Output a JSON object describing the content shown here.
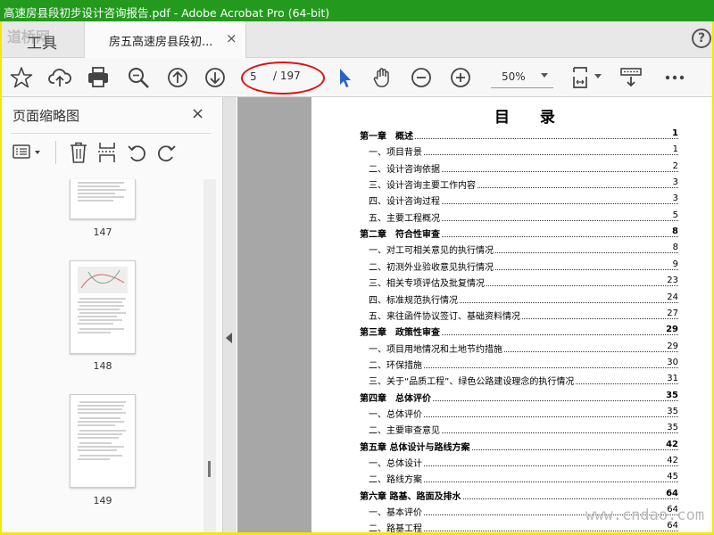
{
  "window": {
    "title": "高速房县段初步设计咨询报告.pdf - Adobe Acrobat Pro (64-bit)"
  },
  "tabs": {
    "tools_label": "工具",
    "doc_label": "房五高速房县段初...",
    "close_glyph": "×",
    "help_glyph": "?"
  },
  "toolbar": {
    "icons": [
      "bookmark-star-icon",
      "upload-cloud-icon",
      "print-icon",
      "search-icon",
      "prev-page-icon",
      "next-page-icon",
      "select-cursor-icon",
      "hand-tool-icon",
      "zoom-out-icon",
      "zoom-in-icon",
      "fit-page-icon",
      "read-mode-icon",
      "more-icon"
    ],
    "page_current": "5",
    "page_total": "/ 197",
    "zoom": "50%"
  },
  "sidebar": {
    "title": "页面缩略图",
    "close_glyph": "×",
    "thumbnails": [
      {
        "label": "147"
      },
      {
        "label": "148"
      },
      {
        "label": "149"
      }
    ]
  },
  "toc": {
    "title": "目 录",
    "entries": [
      {
        "text": "第一章　概述",
        "page": "1",
        "level": "chapter"
      },
      {
        "text": "一、项目背景",
        "page": "1",
        "level": "section"
      },
      {
        "text": "二、设计咨询依据",
        "page": "2",
        "level": "section"
      },
      {
        "text": "三、设计咨询主要工作内容",
        "page": "3",
        "level": "section"
      },
      {
        "text": "四、设计咨询过程",
        "page": "3",
        "level": "section"
      },
      {
        "text": "五、主要工程概况",
        "page": "5",
        "level": "section"
      },
      {
        "text": "第二章　符合性审查",
        "page": "8",
        "level": "chapter"
      },
      {
        "text": "一、对工可相关意见的执行情况",
        "page": "8",
        "level": "section"
      },
      {
        "text": "二、初测外业验收意见执行情况",
        "page": "9",
        "level": "section"
      },
      {
        "text": "三、相关专项评估及批复情况",
        "page": "23",
        "level": "section"
      },
      {
        "text": "四、标准规范执行情况",
        "page": "24",
        "level": "section"
      },
      {
        "text": "五、来往函件协议签订、基础资料情况",
        "page": "27",
        "level": "section"
      },
      {
        "text": "第三章　政策性审查",
        "page": "29",
        "level": "chapter"
      },
      {
        "text": "一、项目用地情况和土地节约措施",
        "page": "29",
        "level": "section"
      },
      {
        "text": "二、环保措施",
        "page": "30",
        "level": "section"
      },
      {
        "text": "三、关于“品质工程”、绿色公路建设理念的执行情况",
        "page": "31",
        "level": "section"
      },
      {
        "text": "第四章　总体评价",
        "page": "35",
        "level": "chapter"
      },
      {
        "text": "一、总体评价",
        "page": "35",
        "level": "section"
      },
      {
        "text": "二、主要审查意见",
        "page": "35",
        "level": "section"
      },
      {
        "text": "第五章 总体设计与路线方案",
        "page": "42",
        "level": "chapter"
      },
      {
        "text": "一、总体设计",
        "page": "42",
        "level": "section"
      },
      {
        "text": "二、路线方案",
        "page": "45",
        "level": "section"
      },
      {
        "text": "第六章 路基、路面及排水",
        "page": "64",
        "level": "chapter"
      },
      {
        "text": "一、基本评价",
        "page": "64",
        "level": "section"
      },
      {
        "text": "二、路基工程",
        "page": "64",
        "level": "section"
      }
    ]
  },
  "watermarks": {
    "top_left": "道桥网",
    "bottom_right": "www.cndao.com"
  },
  "colors": {
    "titlebar": "#239a1d",
    "frame": "#f5e800",
    "annotation": "#e01010",
    "cursor": "#2a62c9"
  }
}
